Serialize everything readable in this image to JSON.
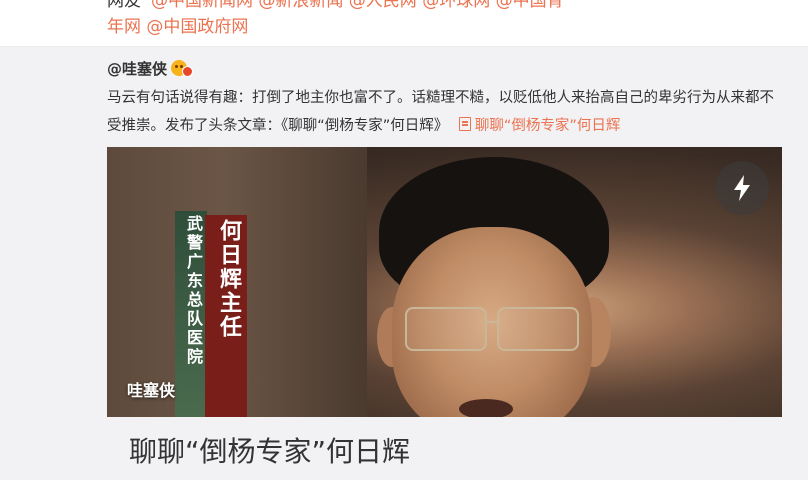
{
  "top": {
    "line1_lead": "网友",
    "line1_mentions": "@中国新闻网 @新浪新闻 @人民网 @环球网 @中国青",
    "line2_mentions": [
      "年网",
      "@中国政府网"
    ]
  },
  "repost": {
    "author": "@哇塞侠",
    "vip_icon": "vip-emoji-icon",
    "text": "马云有句话说得有趣：打倒了地主你也富不了。话糙理不糙，以贬低他人来抬高自己的卑劣行为从来都不受推崇。发布了头条文章：《聊聊“倒杨专家”何日辉》",
    "link_icon": "article-doc-icon",
    "link_text": "聊聊“倒杨专家”何日辉"
  },
  "card": {
    "caption_name": "何日辉主任",
    "caption_org": "武警广东总队医院",
    "watermark": "哇塞侠",
    "flash_icon": "lightning-icon",
    "title": "聊聊“倒杨专家”何日辉"
  },
  "colors": {
    "link": "#eb7350",
    "repost_bg": "#f2f2f5"
  }
}
